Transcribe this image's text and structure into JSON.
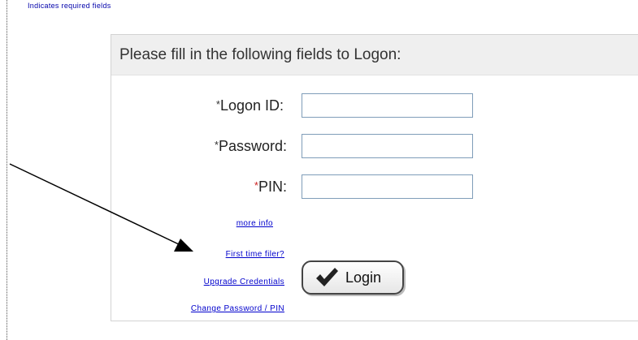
{
  "note": {
    "text": "Indicates required fields"
  },
  "panel": {
    "header": "Please fill in the following fields to Logon:"
  },
  "fields": {
    "logon_id": {
      "label": "Logon ID:",
      "value": "",
      "placeholder": ""
    },
    "password": {
      "label": "Password:",
      "value": "",
      "placeholder": ""
    },
    "pin": {
      "label": "PIN:",
      "value": "",
      "placeholder": ""
    }
  },
  "required_mark": "*",
  "links": {
    "more_info": "more info",
    "first_time_filer": "First time filer?",
    "upgrade_credentials": "Upgrade Credentials",
    "change_password": "Change Password / PIN"
  },
  "login_button": {
    "label": "Login",
    "icon": "checkmark-icon"
  },
  "annotation": {
    "arrow": "arrow-pointing-to-first-time-filer"
  }
}
